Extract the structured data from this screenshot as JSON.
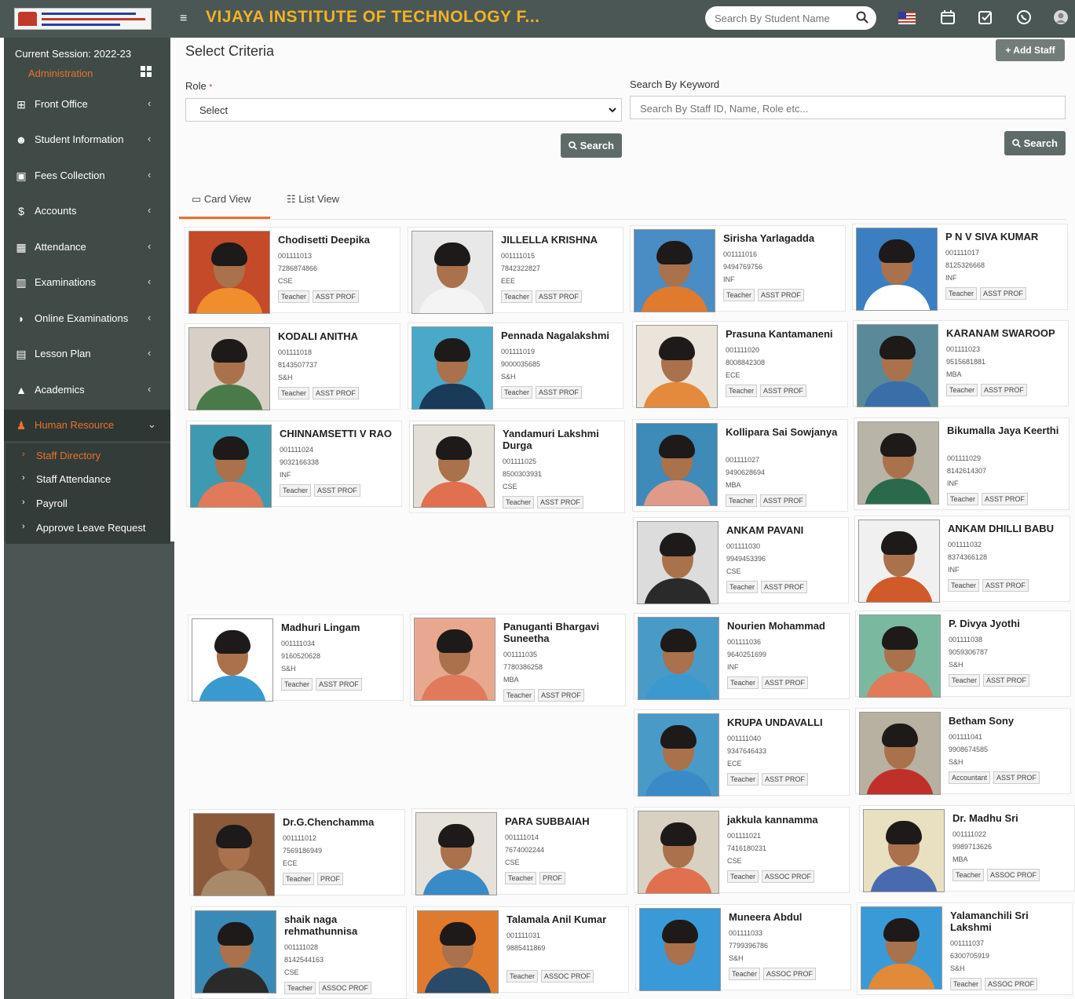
{
  "header": {
    "title": "VIJAYA INSTITUTE OF TECHNOLOGY F...",
    "search_placeholder": "Search By Student Name",
    "logo_text": "Vijaya Institute of Technology for Women"
  },
  "sidebar": {
    "session": "Current Session: 2022-23",
    "admin": "Administration",
    "items": [
      {
        "label": "Front Office",
        "icon": "desk-icon"
      },
      {
        "label": "Student Information",
        "icon": "users-icon"
      },
      {
        "label": "Fees Collection",
        "icon": "money-icon"
      },
      {
        "label": "Accounts",
        "icon": "dollar-icon"
      },
      {
        "label": "Attendance",
        "icon": "calendar-icon"
      },
      {
        "label": "Examinations",
        "icon": "book-icon"
      },
      {
        "label": "Online Examinations",
        "icon": "rss-icon"
      },
      {
        "label": "Lesson Plan",
        "icon": "list-icon"
      },
      {
        "label": "Academics",
        "icon": "graduation-icon"
      },
      {
        "label": "Human Resource",
        "icon": "hr-icon"
      }
    ],
    "sub_items": [
      "Staff Directory",
      "Staff Attendance",
      "Payroll",
      "Approve Leave Request"
    ]
  },
  "criteria": {
    "title": "Select Criteria",
    "role_label": "Role",
    "role_required": "*",
    "role_value": "Select",
    "keyword_label": "Search By Keyword",
    "keyword_placeholder": "Search By Staff ID, Name, Role etc...",
    "search_label": "Search",
    "add_staff": "Add Staff"
  },
  "tabs": {
    "card_view": "Card View",
    "list_view": "List View"
  },
  "staff": [
    {
      "name": "Chodisetti Deepika",
      "id": "001111013",
      "phone": "7286874866",
      "dept": "CSE",
      "role": "Teacher",
      "designation": "ASST PROF"
    },
    {
      "name": "JILLELLA KRISHNA",
      "id": "001111015",
      "phone": "7842322827",
      "dept": "EEE",
      "role": "Teacher",
      "designation": "ASST PROF"
    },
    {
      "name": "Sirisha Yarlagadda",
      "id": "001111016",
      "phone": "9494769756",
      "dept": "INF",
      "role": "Teacher",
      "designation": "ASST PROF"
    },
    {
      "name": "P N V SIVA KUMAR",
      "id": "001111017",
      "phone": "8125326668",
      "dept": "INF",
      "role": "Teacher",
      "designation": "ASST PROF"
    },
    {
      "name": "KODALI ANITHA",
      "id": "001111018",
      "phone": "8143507737",
      "dept": "S&H",
      "role": "Teacher",
      "designation": "ASST PROF"
    },
    {
      "name": "Pennada Nagalakshmi",
      "id": "001111019",
      "phone": "9000035685",
      "dept": "S&H",
      "role": "Teacher",
      "designation": "ASST PROF"
    },
    {
      "name": "Prasuna Kantamaneni",
      "id": "001111020",
      "phone": "8008842308",
      "dept": "ECE",
      "role": "Teacher",
      "designation": "ASST PROF"
    },
    {
      "name": "KARANAM SWAROOP",
      "id": "001111023",
      "phone": "9515681881",
      "dept": "MBA",
      "role": "Teacher",
      "designation": "ASST PROF"
    },
    {
      "name": "CHINNAMSETTI V RAO",
      "id": "001111024",
      "phone": "9032166338",
      "dept": "INF",
      "role": "Teacher",
      "designation": "ASST PROF"
    },
    {
      "name": "Yandamuri Lakshmi Durga",
      "id": "001111025",
      "phone": "8500303931",
      "dept": "CSE",
      "role": "Teacher",
      "designation": "ASST PROF"
    },
    {
      "name": "Kollipara Sai Sowjanya",
      "id": "001111027",
      "phone": "9490628694",
      "dept": "MBA",
      "role": "Teacher",
      "designation": "ASST PROF"
    },
    {
      "name": "Bikumalla Jaya Keerthi",
      "id": "001111029",
      "phone": "8142614307",
      "dept": "INF",
      "role": "Teacher",
      "designation": "ASST PROF"
    },
    {
      "name": "ANKAM PAVANI",
      "id": "001111030",
      "phone": "9949453396",
      "dept": "CSE",
      "role": "Teacher",
      "designation": "ASST PROF"
    },
    {
      "name": "ANKAM DHILLI BABU",
      "id": "001111032",
      "phone": "8374366128",
      "dept": "INF",
      "role": "Teacher",
      "designation": "ASST PROF"
    },
    {
      "name": "Madhuri Lingam",
      "id": "001111034",
      "phone": "9160520628",
      "dept": "S&H",
      "role": "Teacher",
      "designation": "ASST PROF"
    },
    {
      "name": "Panuganti Bhargavi Suneetha",
      "id": "001111035",
      "phone": "7780386258",
      "dept": "MBA",
      "role": "Teacher",
      "designation": "ASST PROF"
    },
    {
      "name": "Nourien Mohammad",
      "id": "001111036",
      "phone": "9640251699",
      "dept": "INF",
      "role": "Teacher",
      "designation": "ASST PROF"
    },
    {
      "name": "P. Divya Jyothi",
      "id": "001111038",
      "phone": "9059306787",
      "dept": "S&H",
      "role": "Teacher",
      "designation": "ASST PROF"
    },
    {
      "name": "KRUPA UNDAVALLI",
      "id": "001111040",
      "phone": "9347646433",
      "dept": "ECE",
      "role": "Teacher",
      "designation": "ASST PROF"
    },
    {
      "name": "Betham Sony",
      "id": "001111041",
      "phone": "9908674585",
      "dept": "S&H",
      "role": "Accountant",
      "designation": "ASST PROF"
    },
    {
      "name": "Dr.G.Chenchamma",
      "id": "001111012",
      "phone": "7569186949",
      "dept": "ECE",
      "role": "Teacher",
      "designation": "PROF"
    },
    {
      "name": "PARA SUBBAIAH",
      "id": "001111014",
      "phone": "7674002244",
      "dept": "CSE",
      "role": "Teacher",
      "designation": "PROF"
    },
    {
      "name": "jakkula kannamma",
      "id": "001111021",
      "phone": "7416180231",
      "dept": "CSE",
      "role": "Teacher",
      "designation": "ASSOC PROF"
    },
    {
      "name": "Dr. Madhu Sri",
      "id": "001111022",
      "phone": "9989713626",
      "dept": "MBA",
      "role": "Teacher",
      "designation": "ASSOC PROF"
    },
    {
      "name": "shaik naga rehmathunnisa",
      "id": "001111028",
      "phone": "8142544163",
      "dept": "CSE",
      "role": "Teacher",
      "designation": "ASSOC PROF"
    },
    {
      "name": "Talamala Anil Kumar",
      "id": "001111031",
      "phone": "9885411869",
      "dept": "",
      "role": "Teacher",
      "designation": "ASSOC PROF"
    },
    {
      "name": "Muneera Abdul",
      "id": "001111033",
      "phone": "7799396786",
      "dept": "S&H",
      "role": "Teacher",
      "designation": "ASSOC PROF"
    },
    {
      "name": "Yalamanchili Sri Lakshmi",
      "id": "001111037",
      "phone": "6300705919",
      "dept": "S&H",
      "role": "Teacher",
      "designation": "ASSOC PROF"
    }
  ],
  "colors": {
    "topbar": "#4a5754",
    "title": "#f5b225",
    "sidebar": "#404b48",
    "accent": "#e8722c",
    "button": "#5f6b68"
  }
}
